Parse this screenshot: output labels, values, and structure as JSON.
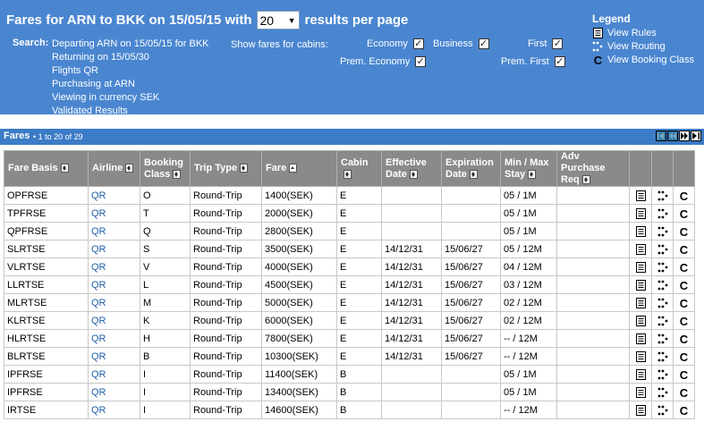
{
  "header": {
    "title_prefix": "Fares for ARN to BKK on 15/05/15 with",
    "results_per_page_value": "20",
    "title_suffix": "results per page"
  },
  "search": {
    "label": "Search:",
    "lines": [
      "Departing ARN on 15/05/15 for BKK",
      "Returning on 15/05/30",
      "Flights QR",
      "Purchasing at ARN",
      "Viewing in currency SEK",
      "Validated Results"
    ]
  },
  "cabins": {
    "label": "Show fares for cabins:",
    "options": [
      {
        "label": "Economy",
        "checked": true
      },
      {
        "label": "Business",
        "checked": true
      },
      {
        "label": "First",
        "checked": true
      },
      {
        "label": "Prem. Economy",
        "checked": true
      },
      {
        "label": "Prem. First",
        "checked": true
      }
    ]
  },
  "legend": {
    "title": "Legend",
    "items": [
      {
        "label": "View Rules",
        "icon": "rules-icon"
      },
      {
        "label": "View Routing",
        "icon": "routing-icon"
      },
      {
        "label": "View Booking Class",
        "icon": "booking-class-icon"
      }
    ]
  },
  "fares_bar": {
    "title": "Fares",
    "range": "• 1 to 20 of 29"
  },
  "table": {
    "columns": [
      {
        "line1": "Fare Basis",
        "line2": ""
      },
      {
        "line1": "Airline",
        "line2": ""
      },
      {
        "line1": "Booking",
        "line2": "Class"
      },
      {
        "line1": "Trip Type",
        "line2": ""
      },
      {
        "line1": "Fare",
        "line2": ""
      },
      {
        "line1": "Cabin",
        "line2": ""
      },
      {
        "line1": "Effective",
        "line2": "Date"
      },
      {
        "line1": "Expiration",
        "line2": "Date"
      },
      {
        "line1": "Min / Max",
        "line2": "Stay"
      },
      {
        "line1": "Adv Purchase",
        "line2": "Req"
      }
    ],
    "rows": [
      [
        "OPFRSE",
        "QR",
        "O",
        "Round-Trip",
        "1400(SEK)",
        "E",
        "",
        "",
        "05 / 1M",
        ""
      ],
      [
        "TPFRSE",
        "QR",
        "T",
        "Round-Trip",
        "2000(SEK)",
        "E",
        "",
        "",
        "05 / 1M",
        ""
      ],
      [
        "QPFRSE",
        "QR",
        "Q",
        "Round-Trip",
        "2800(SEK)",
        "E",
        "",
        "",
        "05 / 1M",
        ""
      ],
      [
        "SLRTSE",
        "QR",
        "S",
        "Round-Trip",
        "3500(SEK)",
        "E",
        "14/12/31",
        "15/06/27",
        "05 / 12M",
        ""
      ],
      [
        "VLRTSE",
        "QR",
        "V",
        "Round-Trip",
        "4000(SEK)",
        "E",
        "14/12/31",
        "15/06/27",
        "04 / 12M",
        ""
      ],
      [
        "LLRTSE",
        "QR",
        "L",
        "Round-Trip",
        "4500(SEK)",
        "E",
        "14/12/31",
        "15/06/27",
        "03 / 12M",
        ""
      ],
      [
        "MLRTSE",
        "QR",
        "M",
        "Round-Trip",
        "5000(SEK)",
        "E",
        "14/12/31",
        "15/06/27",
        "02 / 12M",
        ""
      ],
      [
        "KLRTSE",
        "QR",
        "K",
        "Round-Trip",
        "6000(SEK)",
        "E",
        "14/12/31",
        "15/06/27",
        "02 / 12M",
        ""
      ],
      [
        "HLRTSE",
        "QR",
        "H",
        "Round-Trip",
        "7800(SEK)",
        "E",
        "14/12/31",
        "15/06/27",
        "-- / 12M",
        ""
      ],
      [
        "BLRTSE",
        "QR",
        "B",
        "Round-Trip",
        "10300(SEK)",
        "E",
        "14/12/31",
        "15/06/27",
        "-- / 12M",
        ""
      ],
      [
        "IPFRSE",
        "QR",
        "I",
        "Round-Trip",
        "11400(SEK)",
        "B",
        "",
        "",
        "05 / 1M",
        ""
      ],
      [
        "IPFRSE",
        "QR",
        "I",
        "Round-Trip",
        "13400(SEK)",
        "B",
        "",
        "",
        "05 / 1M",
        ""
      ],
      [
        "IRTSE",
        "QR",
        "I",
        "Round-Trip",
        "14600(SEK)",
        "B",
        "",
        "",
        "-- / 12M",
        ""
      ]
    ]
  },
  "colors": {
    "panel": "#4a86d0",
    "bar": "#3c7bc6",
    "header": "#8a8a8a",
    "link": "#1f5fa8"
  }
}
